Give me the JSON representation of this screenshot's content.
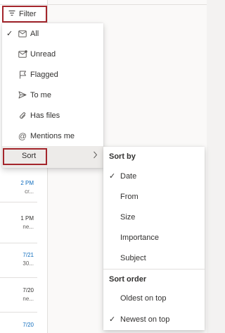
{
  "filter_button": {
    "label": "Filter",
    "icon": "filter-lines-icon"
  },
  "filter_menu": {
    "items": [
      {
        "label": "All",
        "icon": "envelope-icon",
        "checked": true
      },
      {
        "label": "Unread",
        "icon": "unread-envelope-icon",
        "checked": false
      },
      {
        "label": "Flagged",
        "icon": "flag-icon",
        "checked": false
      },
      {
        "label": "To me",
        "icon": "send-arrow-icon",
        "checked": false
      },
      {
        "label": "Has files",
        "icon": "paperclip-icon",
        "checked": false
      },
      {
        "label": "Mentions me",
        "icon": "at-icon",
        "checked": false
      }
    ],
    "sort_label": "Sort"
  },
  "sort_menu": {
    "sort_by_header": "Sort by",
    "sort_by_items": [
      {
        "label": "Date",
        "checked": true
      },
      {
        "label": "From",
        "checked": false
      },
      {
        "label": "Size",
        "checked": false
      },
      {
        "label": "Importance",
        "checked": false
      },
      {
        "label": "Subject",
        "checked": false
      }
    ],
    "sort_order_header": "Sort order",
    "sort_order_items": [
      {
        "label": "Oldest on top",
        "checked": false
      },
      {
        "label": "Newest on top",
        "checked": true
      }
    ]
  },
  "background_list": {
    "snippets": [
      {
        "time": "2 PM",
        "preview": "cr..."
      },
      {
        "time": "1 PM",
        "preview": "ne..."
      },
      {
        "time": "7/21",
        "preview": "30..."
      },
      {
        "time": "7/20",
        "preview": "ne..."
      },
      {
        "time": "7/20",
        "preview": ""
      }
    ]
  },
  "colors": {
    "highlight_border": "#a4262c",
    "link_blue": "#0f6cbd",
    "menu_bg": "#ffffff",
    "hover_bg": "#edebe9"
  }
}
